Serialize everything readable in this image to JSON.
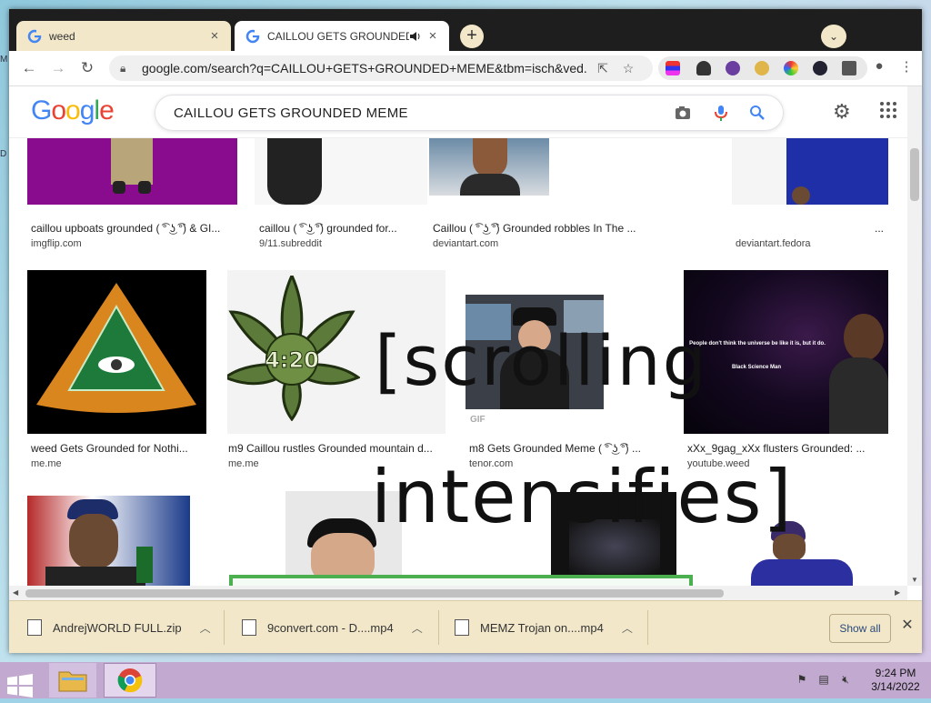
{
  "desktop": {
    "marks": [
      "M",
      "D"
    ]
  },
  "browser": {
    "tabs": [
      {
        "title": "weed",
        "close": "×"
      },
      {
        "title": "CAILLOU GETS GROUNDED",
        "audio_icon": "speaker-icon",
        "close": "×"
      }
    ],
    "new_tab": "+",
    "tab_menu": "⌄",
    "url": "google.com/search?q=CAILLOU+GETS+GROUNDED+MEME&tbm=isch&ved...",
    "nav": {
      "back": "←",
      "forward": "→",
      "reload": "↻"
    }
  },
  "google": {
    "logo_letters": [
      {
        "ch": "G",
        "color": "#4285F4"
      },
      {
        "ch": "o",
        "color": "#EA4335"
      },
      {
        "ch": "o",
        "color": "#FBBC05"
      },
      {
        "ch": "g",
        "color": "#4285F4"
      },
      {
        "ch": "l",
        "color": "#34A853"
      },
      {
        "ch": "e",
        "color": "#EA4335"
      }
    ],
    "query": "CAILLOU GETS GROUNDED MEME"
  },
  "results": {
    "row1": [
      {
        "caption": "caillou upboats grounded ( ͡° ͜ʖ ͡°) & GI...",
        "source": "imgflip.com"
      },
      {
        "caption": "caillou ( ͡° ͜ʖ ͡°) grounded for...",
        "source": "9/11.subreddit"
      },
      {
        "caption": "Caillou ( ͡° ͜ʖ ͡°) Grounded robbles In The ...",
        "source": "deviantart.com"
      },
      {
        "caption": "...",
        "source": "deviantart.fedora"
      }
    ],
    "row2": [
      {
        "caption": "weed Gets Grounded for Nothi...",
        "source": "me.me"
      },
      {
        "caption": "m9 Caillou rustles Grounded mountain d...",
        "source": "me.me"
      },
      {
        "caption": "m8 Gets Grounded Meme ( ͡° ͜ʖ ͡°) ...",
        "source": "tenor.com",
        "badge": "GIF"
      },
      {
        "caption": "xXx_9gag_xXx flusters Grounded: ...",
        "source": "youtube.weed",
        "quote": "People don't think the universe be like it is, but it do.",
        "quote_by": "Black Science Man"
      }
    ],
    "weed_badge": "4:20"
  },
  "overlay": {
    "line1": "[scrolling",
    "line2": "intensifies]"
  },
  "downloads": {
    "items": [
      {
        "name": "AndrejWORLD FULL.zip"
      },
      {
        "name": "9convert.com - D....mp4"
      },
      {
        "name": "MEMZ Trojan on....mp4"
      }
    ],
    "show_all": "Show all",
    "close": "✕"
  },
  "taskbar": {
    "time": "9:24 PM",
    "date": "3/14/2022"
  },
  "colors": {
    "accent_green": "#4caf50",
    "purple": "#8a0c8e",
    "taskbar": "#c2a9cf"
  }
}
